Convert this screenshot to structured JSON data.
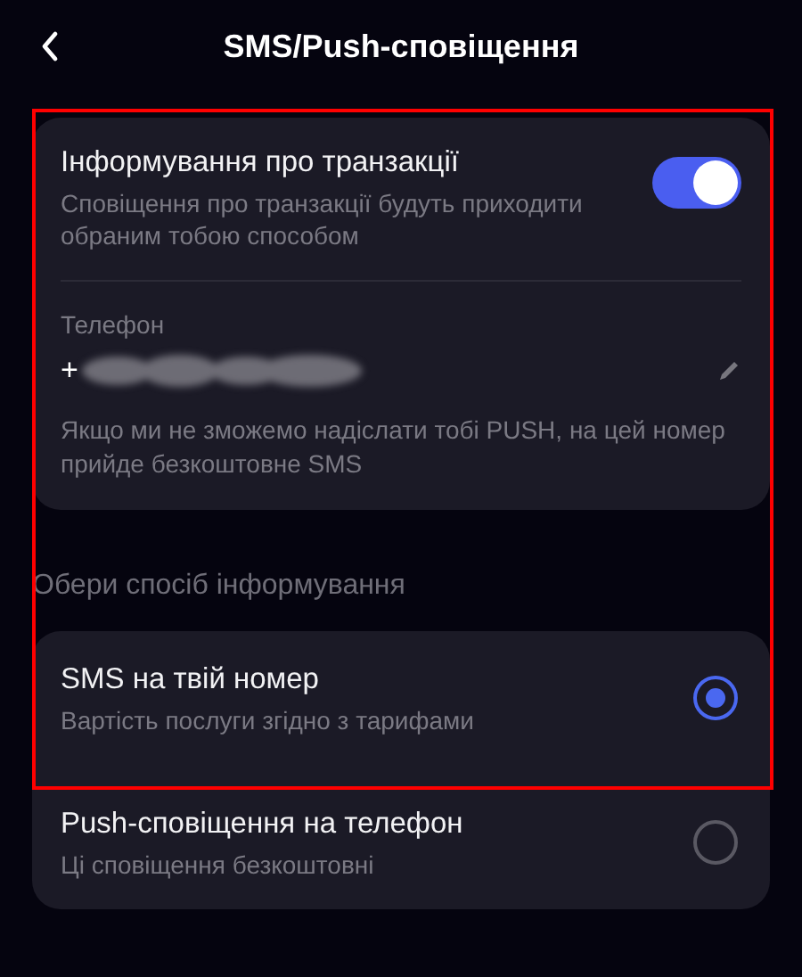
{
  "header": {
    "title": "SMS/Push-сповіщення"
  },
  "transactions_card": {
    "title": "Інформування про транзакції",
    "description": "Сповіщення про транзакції будуть приходити обраним тобою способом",
    "on": true,
    "phone_label": "Телефон",
    "phone_value": "+",
    "phone_note": "Якщо ми не зможемо надіслати тобі PUSH, на цей номер прийде безкоштовне SMS"
  },
  "method_section": {
    "heading": "Обери спосіб інформування",
    "options": [
      {
        "title": "SMS на твій номер",
        "description": "Вартість послуги згідно з тарифами",
        "selected": true
      },
      {
        "title": "Push-сповіщення на телефон",
        "description": "Ці сповіщення безкоштовні",
        "selected": false
      }
    ]
  }
}
